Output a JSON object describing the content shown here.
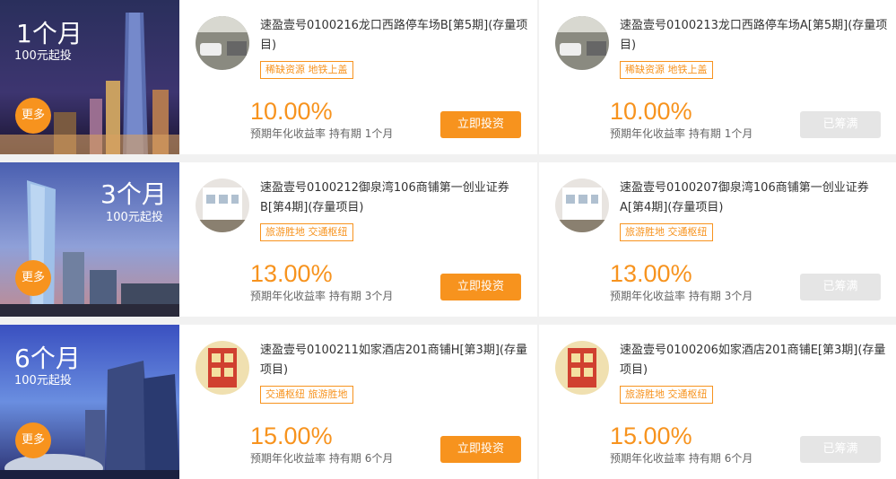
{
  "accent_color": "#f7931e",
  "groups": [
    {
      "term": "1个月",
      "min_invest": "100元起投",
      "more_label": "更多",
      "products": [
        {
          "name": "速盈壹号0100216龙口西路停车场B[第5期](存量项目)",
          "tags": "稀缺资源 地铁上盖",
          "rate": "10.00%",
          "rate_label": "预期年化收益率",
          "period_label": "持有期",
          "period": "1个月",
          "button": "立即投资",
          "thumb_icon": "parking-garage-photo"
        },
        {
          "name": "速盈壹号0100213龙口西路停车场A[第5期](存量项目)",
          "tags": "稀缺资源 地铁上盖",
          "rate": "10.00%",
          "rate_label": "预期年化收益率",
          "period_label": "持有期",
          "period": "1个月",
          "button": "已筹满",
          "thumb_icon": "parking-garage-photo"
        }
      ]
    },
    {
      "term": "3个月",
      "min_invest": "100元起投",
      "more_label": "更多",
      "products": [
        {
          "name": "速盈壹号0100212御泉湾106商铺第一创业证券B[第4期](存量项目)",
          "tags": "旅游胜地 交通枢纽",
          "rate": "13.00%",
          "rate_label": "预期年化收益率",
          "period_label": "持有期",
          "period": "3个月",
          "button": "立即投资",
          "thumb_icon": "shop-building-photo"
        },
        {
          "name": "速盈壹号0100207御泉湾106商铺第一创业证券A[第4期](存量项目)",
          "tags": "旅游胜地 交通枢纽",
          "rate": "13.00%",
          "rate_label": "预期年化收益率",
          "period_label": "持有期",
          "period": "3个月",
          "button": "已筹满",
          "thumb_icon": "shop-building-photo"
        }
      ]
    },
    {
      "term": "6个月",
      "min_invest": "100元起投",
      "more_label": "更多",
      "products": [
        {
          "name": "速盈壹号0100211如家酒店201商铺H[第3期](存量项目)",
          "tags": "交通枢纽 旅游胜地",
          "rate": "15.00%",
          "rate_label": "预期年化收益率",
          "period_label": "持有期",
          "period": "6个月",
          "button": "立即投资",
          "thumb_icon": "hotel-sign-photo"
        },
        {
          "name": "速盈壹号0100206如家酒店201商铺E[第3期](存量项目)",
          "tags": "旅游胜地 交通枢纽",
          "rate": "15.00%",
          "rate_label": "预期年化收益率",
          "period_label": "持有期",
          "period": "6个月",
          "button": "已筹满",
          "thumb_icon": "hotel-sign-photo"
        }
      ]
    }
  ]
}
